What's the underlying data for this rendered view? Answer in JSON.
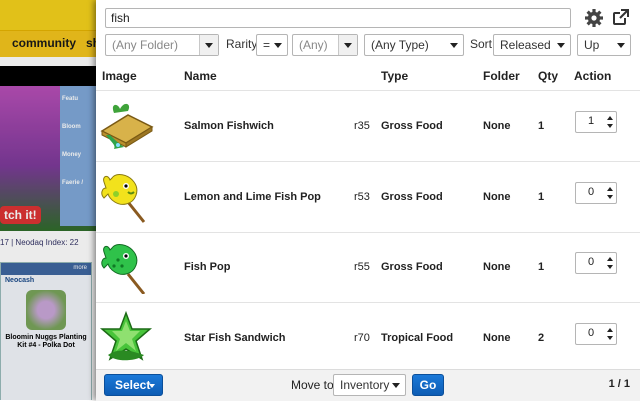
{
  "background_site": {
    "nav_items": [
      "community",
      "sh"
    ],
    "sidebar_links": [
      "Featu",
      "Bloom",
      "Money",
      "Faerie /"
    ],
    "sitch_text": "tch it!",
    "index_text": "17 | Neodaq Index: 22",
    "box_title": "Neocash",
    "box_more": "more",
    "box_item_text": "Bloomin Nuggs Planting Kit #4 - Polka Dot"
  },
  "search": {
    "value": "fish",
    "settings_icon": "gear-icon",
    "popout_icon": "external-link-icon"
  },
  "filters": {
    "folder": "(Any Folder)",
    "rarity_label": "Rarity",
    "rarity_op": "=",
    "rarity_value": "(Any)",
    "type": "(Any Type)",
    "sort_label": "Sort",
    "sort_by": "Released",
    "sort_dir": "Up"
  },
  "table": {
    "headers": {
      "image": "Image",
      "name": "Name",
      "type": "Type",
      "folder": "Folder",
      "qty": "Qty",
      "action": "Action"
    },
    "rows": [
      {
        "name": "Salmon Fishwich",
        "rarity": "r35",
        "type": "Gross Food",
        "folder": "None",
        "qty": "1",
        "action_qty": "1",
        "image": "salmon-fishwich"
      },
      {
        "name": "Lemon and Lime Fish Pop",
        "rarity": "r53",
        "type": "Gross Food",
        "folder": "None",
        "qty": "1",
        "action_qty": "0",
        "image": "lemon-lime-fish-pop"
      },
      {
        "name": "Fish Pop",
        "rarity": "r55",
        "type": "Gross Food",
        "folder": "None",
        "qty": "1",
        "action_qty": "0",
        "image": "fish-pop"
      },
      {
        "name": "Star Fish Sandwich",
        "rarity": "r70",
        "type": "Tropical Food",
        "folder": "None",
        "qty": "2",
        "action_qty": "0",
        "image": "star-fish-sandwich"
      }
    ]
  },
  "footer": {
    "select_label": "Select",
    "move_to_label": "Move to:",
    "move_to_value": "Inventory",
    "go_label": "Go",
    "pager": "1 / 1"
  },
  "colors": {
    "primary_button": "#1268c6",
    "site_yellow": "#f5d21c"
  }
}
